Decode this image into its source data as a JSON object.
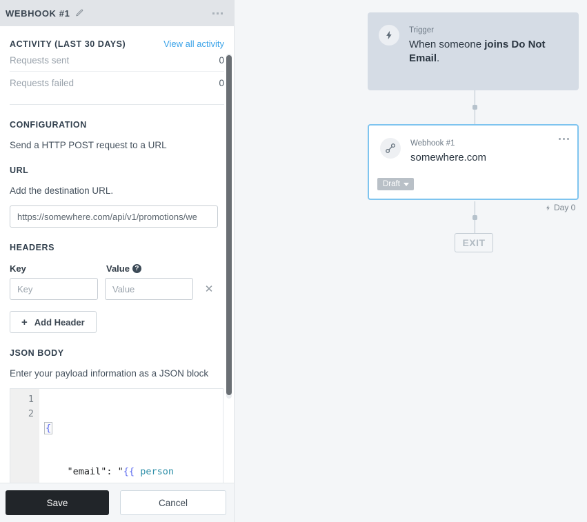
{
  "panel": {
    "title": "WEBHOOK #1",
    "edit_icon": "pencil-icon",
    "kebab_icon": "kebab-menu-icon",
    "activity": {
      "heading": "ACTIVITY (LAST 30 DAYS)",
      "view_all_label": "View all activity",
      "rows": [
        {
          "label": "Requests sent",
          "value": "0"
        },
        {
          "label": "Requests failed",
          "value": "0"
        }
      ]
    },
    "configuration": {
      "heading": "CONFIGURATION",
      "description": "Send a HTTP POST request to a URL"
    },
    "url": {
      "heading": "URL",
      "description": "Add the destination URL.",
      "value": "https://somewhere.com/api/v1/promotions/we",
      "placeholder": "https://"
    },
    "headers": {
      "heading": "HEADERS",
      "key_label": "Key",
      "value_label": "Value",
      "help_icon": "help-circle-icon",
      "key_placeholder": "Key",
      "value_placeholder": "Value",
      "remove_icon": "close-x-icon",
      "add_label": "Add Header",
      "add_icon": "plus-icon"
    },
    "json_body": {
      "heading": "JSON BODY",
      "description": "Enter your payload information as a JSON block",
      "lines": [
        {
          "number": "1",
          "text": "{"
        },
        {
          "number": "2",
          "text": "    \"email\": \"{{ person"
        }
      ],
      "line1_brace": "{",
      "line2_prefix": "    \"email\": \"",
      "line2_braces": "{{",
      "line2_var": " person"
    },
    "footer": {
      "save_label": "Save",
      "cancel_label": "Cancel"
    },
    "scrollbar": "vertical-scrollbar"
  },
  "canvas": {
    "trigger": {
      "kicker": "Trigger",
      "text_prefix": "When someone ",
      "text_bold": "joins Do Not Email",
      "text_suffix": ".",
      "icon": "lightning-bolt-icon"
    },
    "webhook": {
      "kicker": "Webhook #1",
      "title": "somewhere.com",
      "icon": "link-chain-icon",
      "kebab_icon": "kebab-menu-icon",
      "badge_label": "Draft",
      "badge_caret": "chevron-down-icon"
    },
    "day_label": "Day 0",
    "day_icon": "lightning-bolt-icon",
    "exit_label": "EXIT"
  },
  "colors": {
    "accent_blue": "#3ba3e8",
    "selection_blue": "#7ec4ef",
    "trigger_bg": "#d5dce5",
    "save_bg": "#212529",
    "badge_gray": "#b9c0c7",
    "canvas_bg": "#f4f6f8"
  }
}
